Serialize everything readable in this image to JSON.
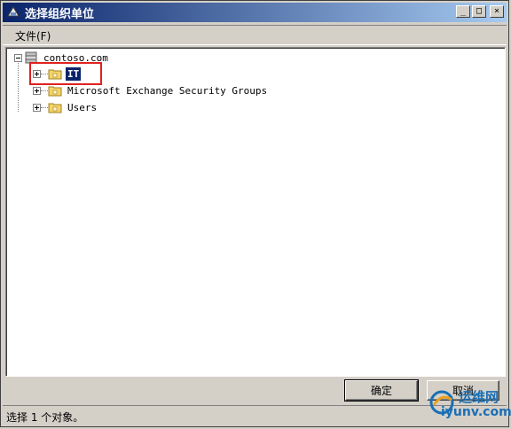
{
  "window": {
    "title": "选择组织单位",
    "minimize": "_",
    "maximize": "□",
    "close": "×"
  },
  "menu": {
    "file": "文件(F)"
  },
  "tree": {
    "root": {
      "label": "contoso.com",
      "expander": "collapse"
    },
    "children": [
      {
        "label": "IT",
        "selected": true,
        "expander": "expand"
      },
      {
        "label": "Microsoft Exchange Security Groups",
        "selected": false,
        "expander": "expand"
      },
      {
        "label": "Users",
        "selected": false,
        "expander": "expand"
      }
    ]
  },
  "buttons": {
    "ok": "确定",
    "cancel": "取消"
  },
  "status": {
    "text": "选择 1 个对象。"
  },
  "watermark": {
    "cn": "运维网",
    "en": "iyunv.com"
  },
  "colors": {
    "title_bar": "#0a246a",
    "selection": "#0a246a",
    "highlight_box": "#e02020",
    "watermark": "#1a6fb5"
  },
  "icons": {
    "window": "domain-icon",
    "root": "domain-icon",
    "ou": "folder-icon"
  }
}
